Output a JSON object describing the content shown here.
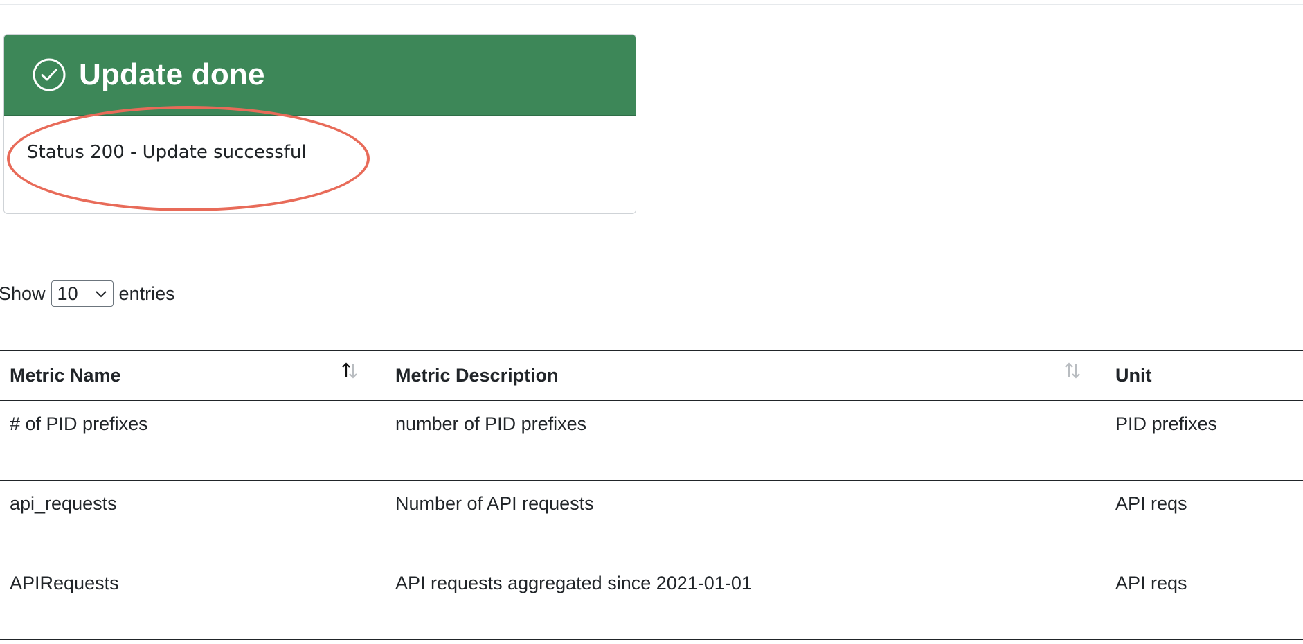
{
  "alert": {
    "title": "Update done",
    "message": "Status 200 - Update successful",
    "icon": "check-circle-icon",
    "header_color": "#3d8758",
    "highlight_color": "#e86b59"
  },
  "length_menu": {
    "show_label": "Show",
    "selected": "10",
    "entries_label": "entries"
  },
  "table": {
    "columns": [
      {
        "label": "Metric Name",
        "sort": "ascending"
      },
      {
        "label": "Metric Description",
        "sort": "none"
      },
      {
        "label": "Unit",
        "sort": "none"
      }
    ],
    "rows": [
      {
        "name": "# of PID prefixes",
        "description": "number of PID prefixes",
        "unit": "PID prefixes"
      },
      {
        "name": "api_requests",
        "description": "Number of API requests",
        "unit": "API reqs"
      },
      {
        "name": "APIRequests",
        "description": "API requests aggregated since 2021-01-01",
        "unit": "API reqs"
      }
    ]
  }
}
